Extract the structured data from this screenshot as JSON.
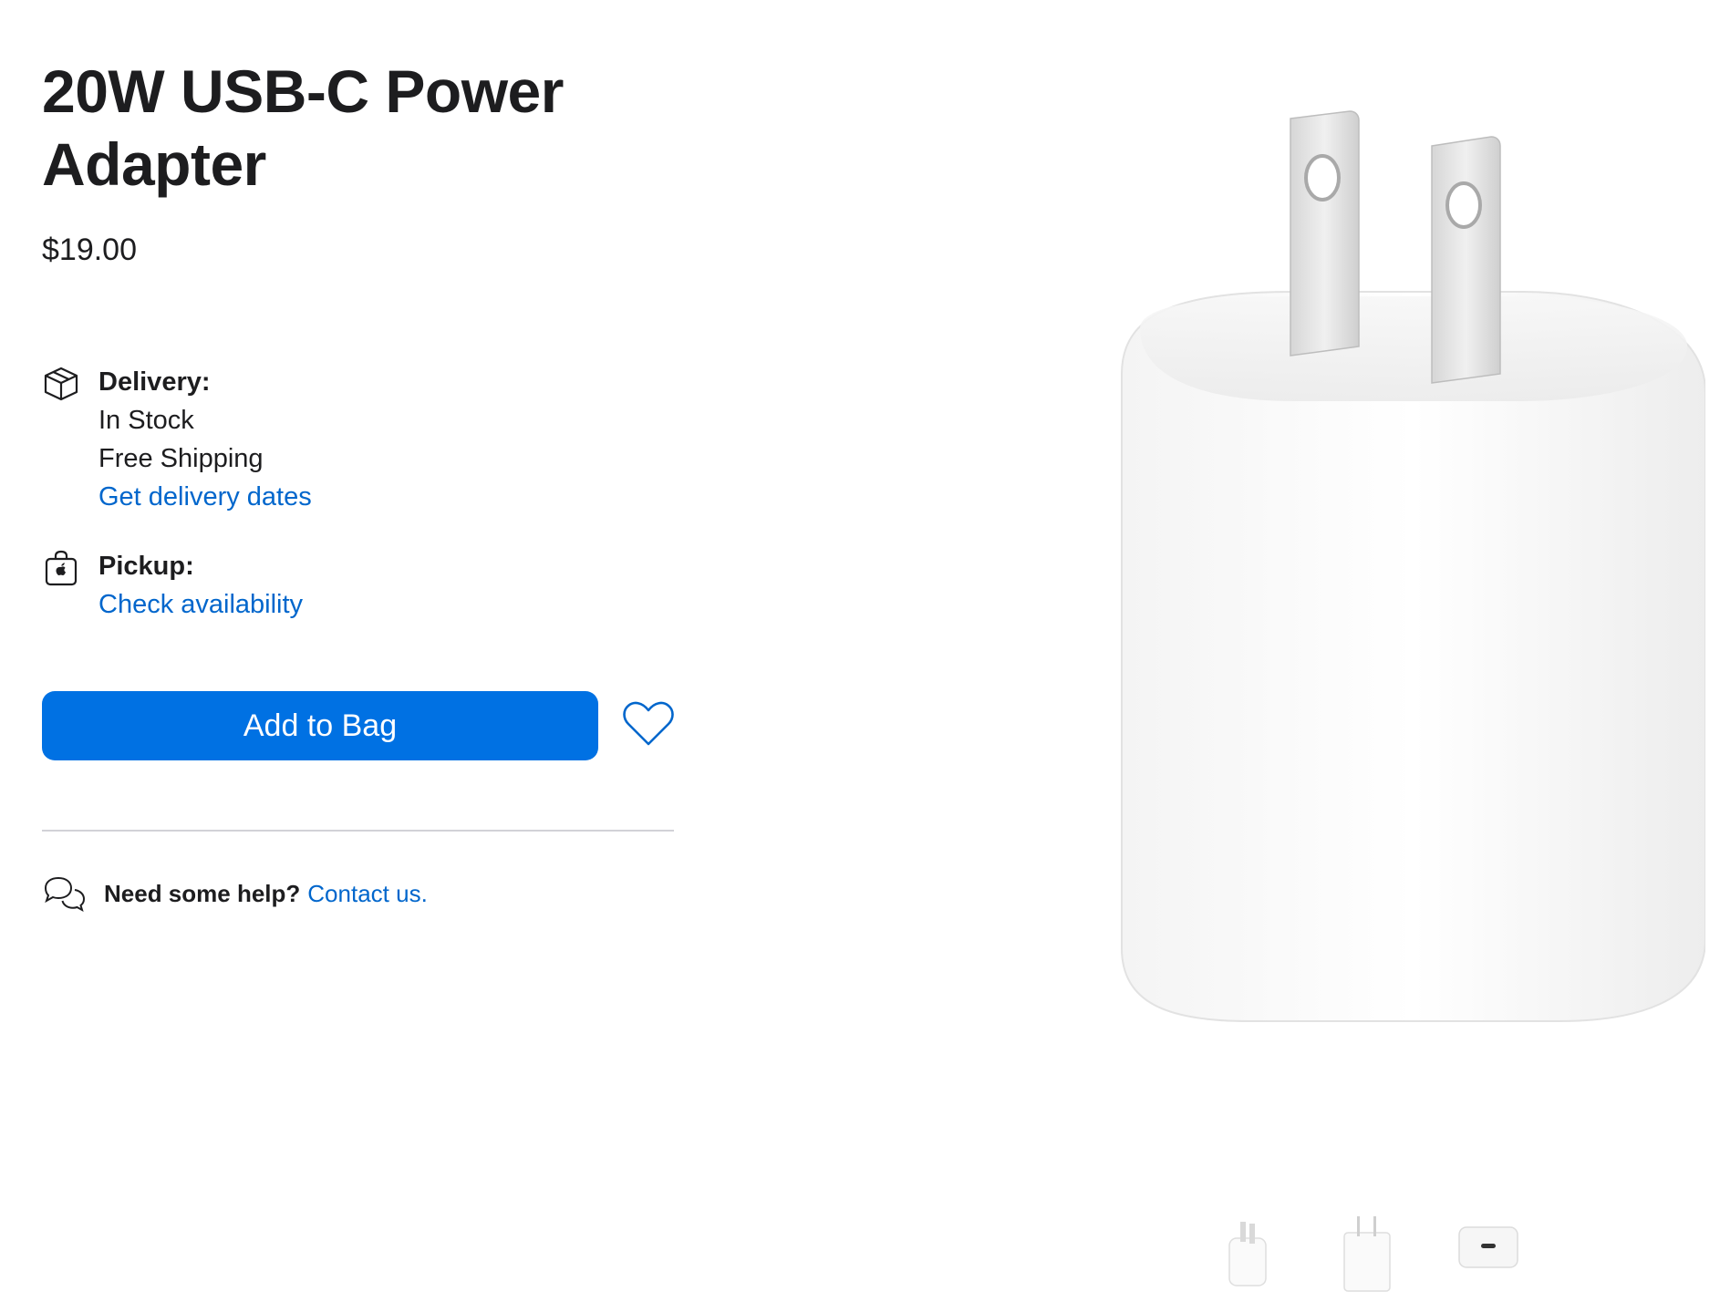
{
  "product": {
    "title": "20W USB-C Power Adapter",
    "price": "$19.00"
  },
  "delivery": {
    "icon": "box-icon",
    "label": "Delivery:",
    "stock": "In Stock",
    "shipping": "Free Shipping",
    "link": "Get delivery dates"
  },
  "pickup": {
    "icon": "shopping-bag-apple-icon",
    "label": "Pickup:",
    "link": "Check availability"
  },
  "actions": {
    "add_to_bag": "Add to Bag",
    "favorite_icon": "heart-icon"
  },
  "help": {
    "icon": "chat-bubbles-icon",
    "text": "Need some help?",
    "link": "Contact us."
  },
  "gallery": {
    "thumbnails": [
      "adapter-angle-view",
      "adapter-front-view",
      "adapter-port-view"
    ]
  },
  "colors": {
    "accent": "#0071e3",
    "link": "#0066cc",
    "text": "#1d1d1f",
    "divider": "#d2d2d7"
  }
}
